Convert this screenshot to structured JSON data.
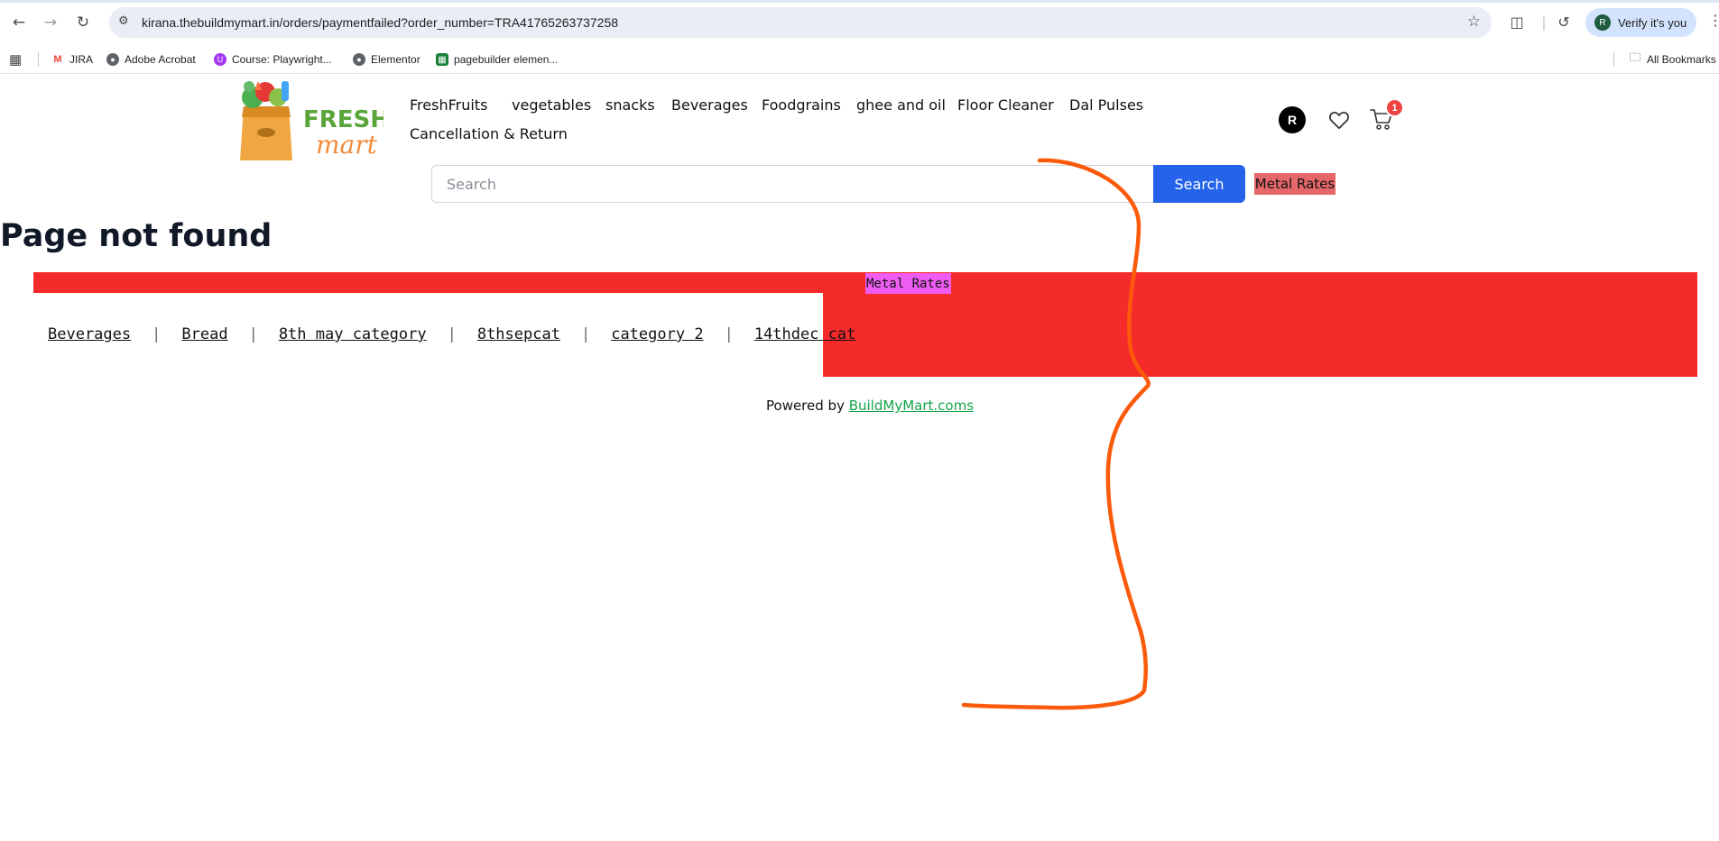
{
  "browser": {
    "url": "kirana.thebuildmymart.in/orders/paymentfailed?order_number=TRA41765263737258",
    "profile_initial": "R",
    "profile_label": "Verify it's you",
    "bookmarks": [
      {
        "label": "JIRA",
        "icon": "gmail-icon"
      },
      {
        "label": "Adobe Acrobat",
        "icon": "globe-icon"
      },
      {
        "label": "Course: Playwright...",
        "icon": "course-icon"
      },
      {
        "label": "Elementor",
        "icon": "globe-icon"
      },
      {
        "label": "pagebuilder elemen...",
        "icon": "sheets-icon"
      }
    ],
    "all_bookmarks": "All Bookmarks"
  },
  "site": {
    "logo": {
      "line1": "FRESH",
      "line2": "mart"
    },
    "nav": [
      "FreshFruits",
      "vegetables",
      "snacks",
      "Beverages",
      "Foodgrains",
      "ghee and oil",
      "Floor Cleaner",
      "Dal Pulses",
      "Cancellation & Return"
    ],
    "account_initial": "R",
    "cart_count": "1",
    "search": {
      "placeholder": "Search",
      "button": "Search"
    },
    "metal_rates_label": "Metal Rates"
  },
  "main": {
    "title": "Page not found",
    "metal_rates_label": "Metal Rates",
    "categories": [
      "Beverages",
      "Bread",
      "8th may category",
      "8thsepcat",
      "category 2",
      "14thdec cat"
    ],
    "separator": "|"
  },
  "footer": {
    "prefix": "Powered by",
    "link": "BuildMyMart.coms"
  },
  "colors": {
    "band": "#f52a2a",
    "metal_mid_bg": "#ee5cf3",
    "metal_top_bg": "#e5676a",
    "search_button": "#2563eb",
    "footer_link": "#16a34a",
    "annotation_stroke": "#fb5a0a"
  }
}
